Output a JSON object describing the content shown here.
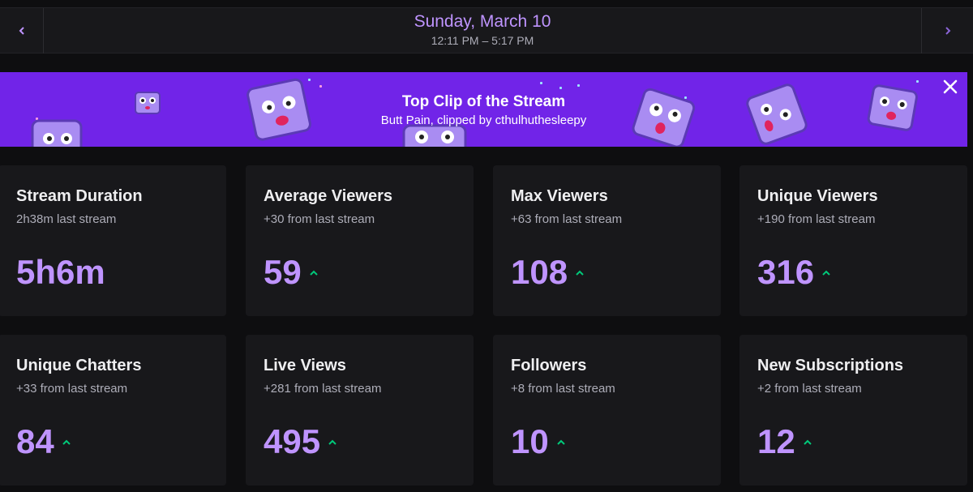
{
  "header": {
    "date": "Sunday, March 10",
    "time_range": "12:11 PM – 5:17 PM",
    "prev_icon": "chevron-left-icon",
    "next_icon": "chevron-right-icon"
  },
  "banner": {
    "title": "Top Clip of the Stream",
    "subtitle": "Butt Pain, clipped by cthulhuthesleepy",
    "close_icon": "close-icon",
    "background": "#7124e8"
  },
  "stats": [
    {
      "title": "Stream Duration",
      "subtitle": "2h38m last stream",
      "value": "5h6m",
      "trend": "none"
    },
    {
      "title": "Average Viewers",
      "subtitle": "+30 from last stream",
      "value": "59",
      "trend": "up"
    },
    {
      "title": "Max Viewers",
      "subtitle": "+63 from last stream",
      "value": "108",
      "trend": "up"
    },
    {
      "title": "Unique Viewers",
      "subtitle": "+190 from last stream",
      "value": "316",
      "trend": "up"
    },
    {
      "title": "Unique Chatters",
      "subtitle": "+33 from last stream",
      "value": "84",
      "trend": "up"
    },
    {
      "title": "Live Views",
      "subtitle": "+281 from last stream",
      "value": "495",
      "trend": "up"
    },
    {
      "title": "Followers",
      "subtitle": "+8 from last stream",
      "value": "10",
      "trend": "up"
    },
    {
      "title": "New Subscriptions",
      "subtitle": "+2 from last stream",
      "value": "12",
      "trend": "up"
    }
  ],
  "colors": {
    "accent": "#bf94ff",
    "trend_up": "#00c97a",
    "card_bg": "#18181b",
    "page_bg": "#0e0e10"
  }
}
